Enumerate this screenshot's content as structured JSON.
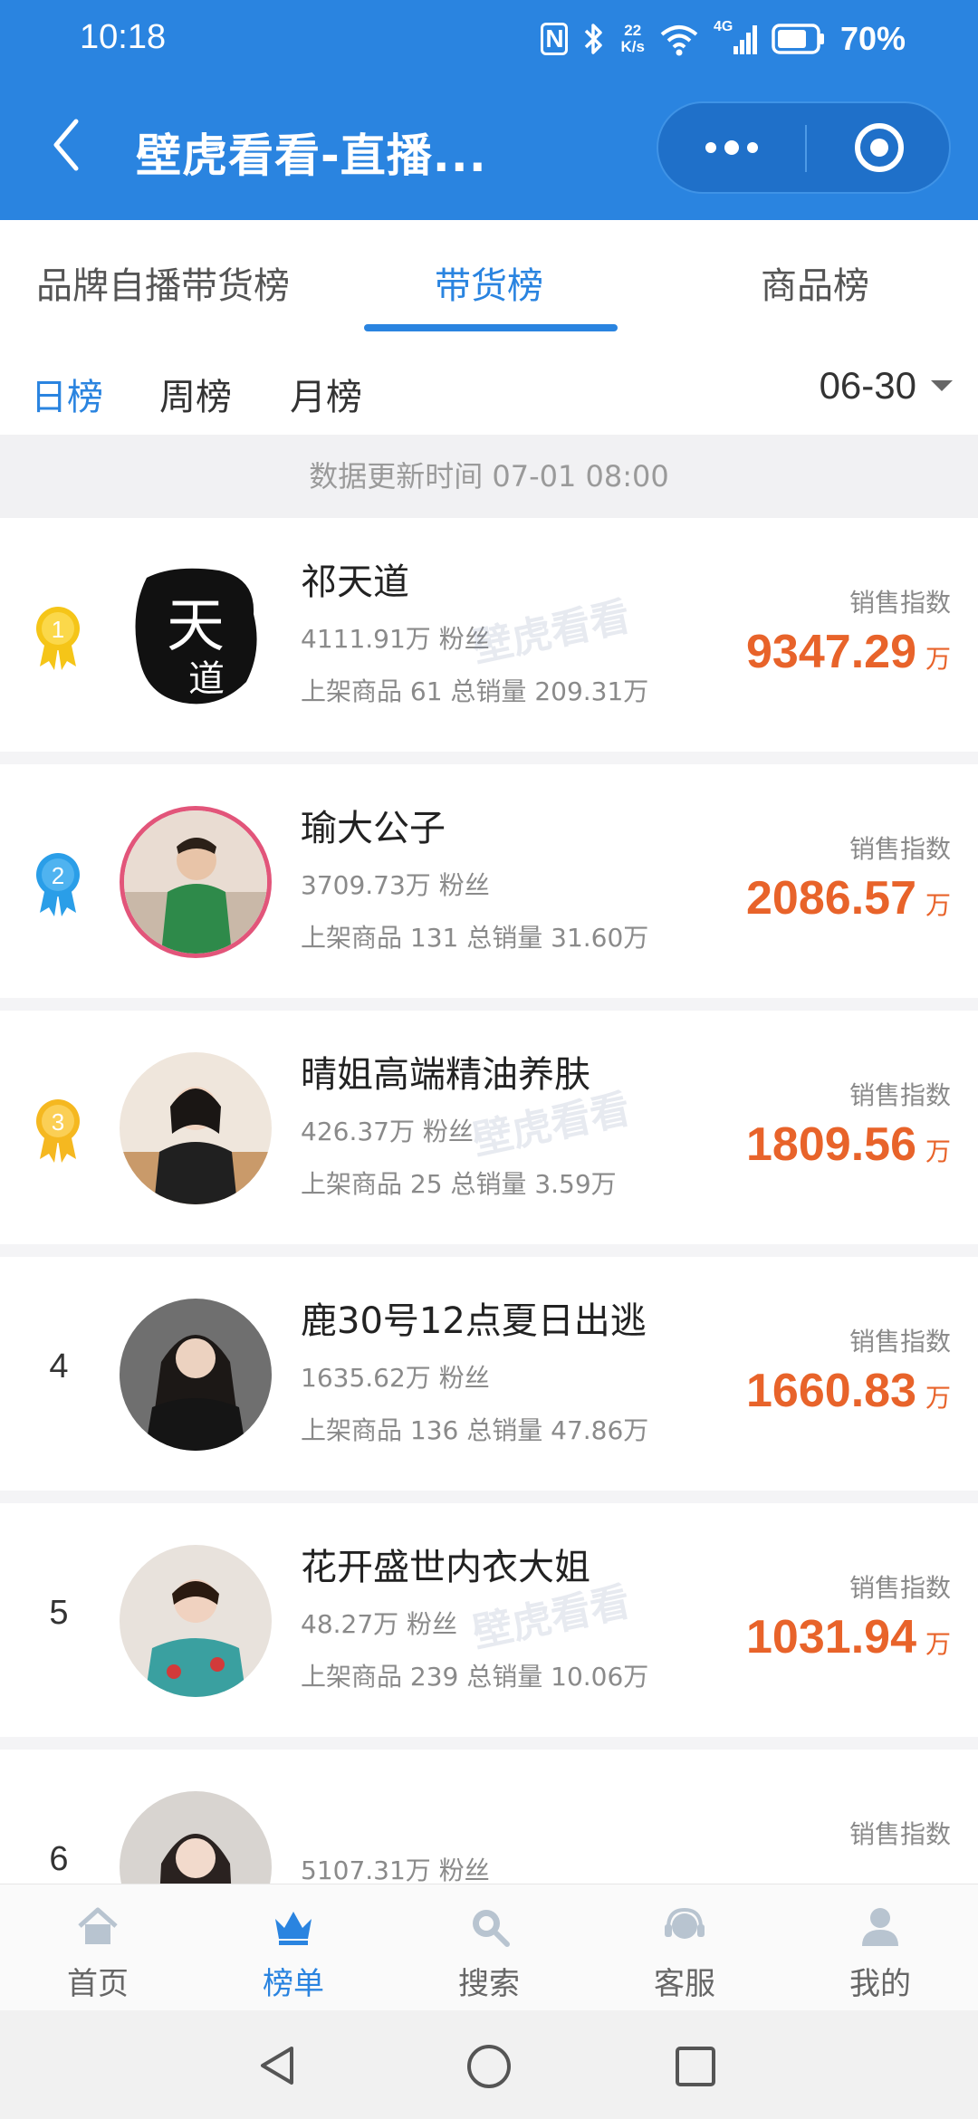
{
  "status_bar": {
    "time": "10:18",
    "nfc": "N",
    "net_speed_value": "22",
    "net_speed_unit": "K/s",
    "signal_type": "4G",
    "battery": "70%"
  },
  "header": {
    "title": "壁虎看看-直播...",
    "back_icon": "chevron-left-icon",
    "more_icon": "more-dots-icon",
    "close_icon": "target-circle-icon"
  },
  "tabs": [
    {
      "label": "品牌自播带货榜",
      "active": false
    },
    {
      "label": "带货榜",
      "active": true
    },
    {
      "label": "商品榜",
      "active": false
    }
  ],
  "period_tabs": [
    {
      "label": "日榜",
      "active": true
    },
    {
      "label": "周榜",
      "active": false
    },
    {
      "label": "月榜",
      "active": false
    }
  ],
  "date_selector": "06-30",
  "update_time": "数据更新时间 07-01 08:00",
  "index_label": "销售指数",
  "index_unit": "万",
  "watermark": "壁虎看看",
  "ranking": [
    {
      "rank": "1",
      "name": "祁天道",
      "fans": "4111.91万 粉丝",
      "stats": "上架商品 61 总销量 209.31万",
      "index": "9347.29",
      "medal_color": "#f5c518"
    },
    {
      "rank": "2",
      "name": "瑜大公子",
      "fans": "3709.73万 粉丝",
      "stats": "上架商品 131 总销量 31.60万",
      "index": "2086.57",
      "medal_color": "#2a9ee8"
    },
    {
      "rank": "3",
      "name": "晴姐高端精油养肤",
      "fans": "426.37万 粉丝",
      "stats": "上架商品 25 总销量 3.59万",
      "index": "1809.56",
      "medal_color": "#f5b820"
    },
    {
      "rank": "4",
      "name": "鹿30号12点夏日出逃",
      "fans": "1635.62万 粉丝",
      "stats": "上架商品 136 总销量 47.86万",
      "index": "1660.83",
      "medal_color": ""
    },
    {
      "rank": "5",
      "name": "花开盛世内衣大姐",
      "fans": "48.27万 粉丝",
      "stats": "上架商品 239 总销量 10.06万",
      "index": "1031.94",
      "medal_color": ""
    },
    {
      "rank": "6",
      "name": "",
      "fans": "5107.31万 粉丝",
      "stats": "",
      "index": "",
      "medal_color": ""
    }
  ],
  "bottom_nav": [
    {
      "label": "首页",
      "icon": "home-icon",
      "active": false
    },
    {
      "label": "榜单",
      "icon": "crown-icon",
      "active": true
    },
    {
      "label": "搜索",
      "icon": "search-icon",
      "active": false
    },
    {
      "label": "客服",
      "icon": "headset-icon",
      "active": false
    },
    {
      "label": "我的",
      "icon": "user-icon",
      "active": false
    }
  ],
  "colors": {
    "brand_blue": "#2a84e0",
    "index_orange": "#e8632a"
  }
}
